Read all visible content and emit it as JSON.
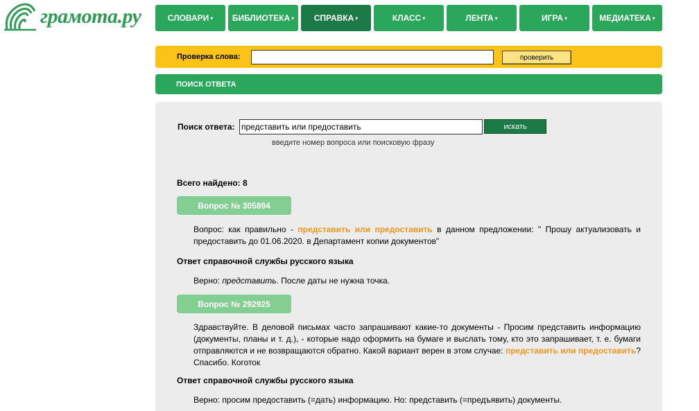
{
  "logo": {
    "text": "грамота.ру"
  },
  "nav": [
    {
      "label": "СЛОВАРИ"
    },
    {
      "label": "БИБЛИОТЕКА"
    },
    {
      "label": "СПРАВКА"
    },
    {
      "label": "КЛАСС"
    },
    {
      "label": "ЛЕНТА"
    },
    {
      "label": "ИГРА"
    },
    {
      "label": "МЕДИАТЕКА"
    }
  ],
  "nav_caret": "▾",
  "word_check": {
    "label": "Проверка слова:",
    "value": "",
    "button": "проверить"
  },
  "section": {
    "title": "ПОИСК ОТВЕТА"
  },
  "search": {
    "label": "Поиск ответа:",
    "value": "представить или предоставить",
    "button": "искать",
    "hint": "введите номер вопроса или поисковую фразу"
  },
  "results": {
    "total_label": "Всего найдено: 8",
    "answer_header": "Ответ справочной службы русского языка",
    "items": [
      {
        "badge": "Вопрос № 305894",
        "q_before": "Вопрос: как правильно - ",
        "q_highlight": "представить или предоставить",
        "q_after": " в данном предложении: \" Прошу актуализовать и предоставить до 01.06.2020. в Департамент копии документов\"",
        "a_before": "Верно: ",
        "a_italic": "представить",
        "a_after": ". После даты не нужна точка."
      },
      {
        "badge": "Вопрос № 292925",
        "q_before": "Здравствуйте. В деловой письмах часто запрашивают какие-то документы - Просим представить информацию (документы, планы и т. д.), - которые надо оформить на бумаге и выслать тому, кто это запрашивает, т. е. бумаги отправляются и не возвращаются обратно. Какой вариант верен в этом случае: ",
        "q_highlight": "представить или предоставить",
        "q_after": "? Спасибо. Коготок",
        "a_before": "Верно: просим предоставить (=дать) информацию. Но: представить (=предъявить) документы.",
        "a_italic": "",
        "a_after": ""
      }
    ]
  },
  "colors": {
    "nav_green": "#2aa75a",
    "nav_active": "#1b7a45",
    "check_bar": "#fbc217",
    "badge": "#83cf93",
    "highlight": "#f0951f",
    "panel": "#ececec"
  }
}
